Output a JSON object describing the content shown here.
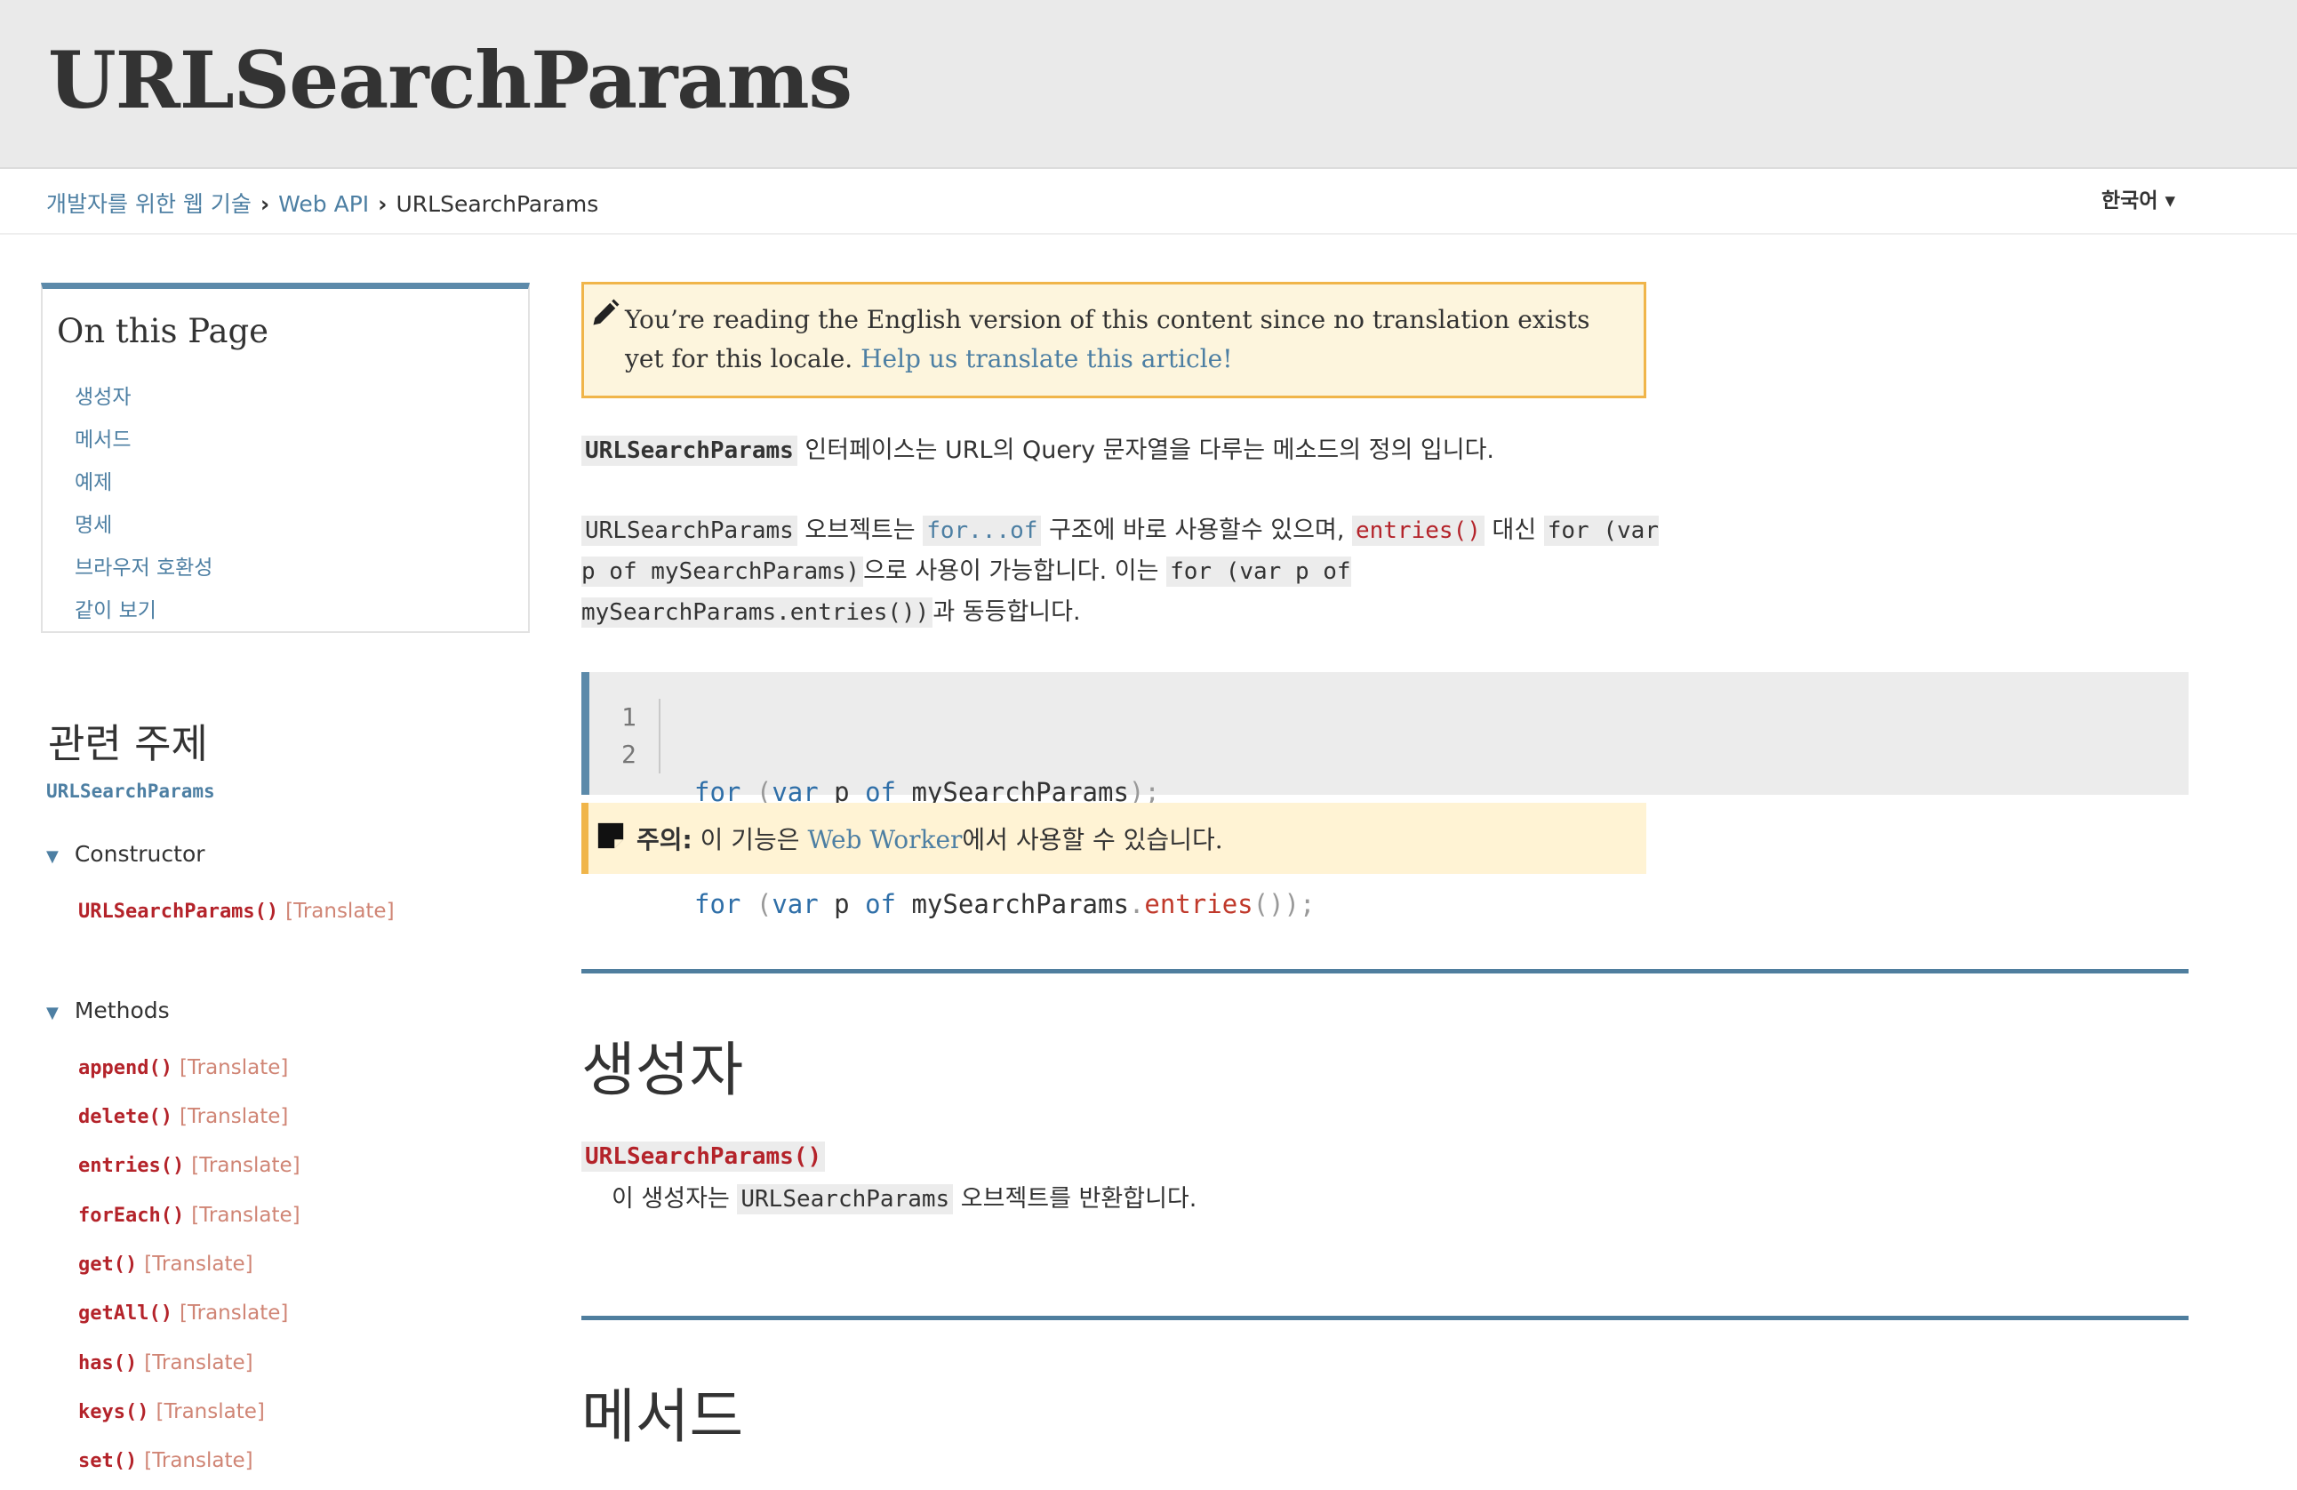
{
  "header": {
    "title": "URLSearchParams"
  },
  "breadcrumb": {
    "items": [
      "개발자를 위한 웹 기술",
      "Web API",
      "URLSearchParams"
    ],
    "separator": "›"
  },
  "language": {
    "label": "한국어 ▾"
  },
  "toc": {
    "title": "On this Page",
    "items": [
      "생성자",
      "메서드",
      "예제",
      "명세",
      "브라우저 호환성",
      "같이 보기"
    ]
  },
  "related": {
    "title": "관련 주제",
    "link": "URLSearchParams",
    "groups": [
      {
        "label": "Constructor",
        "items": [
          {
            "code": "URLSearchParams()",
            "translate": "[Translate]"
          }
        ]
      },
      {
        "label": "Methods",
        "items": [
          {
            "code": "append()",
            "translate": "[Translate]"
          },
          {
            "code": "delete()",
            "translate": "[Translate]"
          },
          {
            "code": "entries()",
            "translate": "[Translate]"
          },
          {
            "code": "forEach()",
            "translate": "[Translate]"
          },
          {
            "code": "get()",
            "translate": "[Translate]"
          },
          {
            "code": "getAll()",
            "translate": "[Translate]"
          },
          {
            "code": "has()",
            "translate": "[Translate]"
          },
          {
            "code": "keys()",
            "translate": "[Translate]"
          },
          {
            "code": "set()",
            "translate": "[Translate]"
          }
        ]
      }
    ]
  },
  "notice": {
    "text": "You’re reading the English version of this content since no translation exists yet for this locale.",
    "link": "Help us translate this article!"
  },
  "intro": {
    "code": "URLSearchParams",
    "text": " 인터페이스는 URL의 Query 문자열을 다루는 메소드의 정의 입니다."
  },
  "usage": {
    "code1": "URLSearchParams",
    "text1": " 오브젝트는 ",
    "link1": "for...of",
    "text2": " 구조에 바로 사용할수 있으며, ",
    "code2": "entries()",
    "text3": " 대신 ",
    "code3": "for (var p of mySearchParams)",
    "text4": "으로 사용이 가능합니다. 이는 ",
    "code4": "for (var p of mySearchParams.entries())",
    "text5": "과 동등합니다."
  },
  "code_example": {
    "line_numbers": [
      "1",
      "2"
    ],
    "line1": {
      "kw1": "for",
      "p1": " (",
      "kw2": "var",
      "t1": " p ",
      "kw3": "of",
      "t2": " mySearchParams",
      "p2": ");"
    },
    "line2": {
      "kw1": "for",
      "p1": " (",
      "kw2": "var",
      "t1": " p ",
      "kw3": "of",
      "t2": " mySearchParams",
      "p2": ".",
      "prop": "entries",
      "p3": "());"
    }
  },
  "note": {
    "label": "주의:",
    "text1": " 이 기능은 ",
    "link": "Web Worker",
    "text2": "에서 사용할 수 있습니다."
  },
  "constructor_section": {
    "heading": "생성자",
    "term": "URLSearchParams()",
    "desc_before": "이 생성자는 ",
    "desc_code": "URLSearchParams",
    "desc_after": " 오브젝트를 반환합니다."
  },
  "methods_section": {
    "heading": "메서드"
  },
  "colors": {
    "link": "#4d7fa3",
    "code_red": "#b4232a",
    "accent_rule": "#4f7e9e",
    "notice_border": "#f0b54a"
  }
}
